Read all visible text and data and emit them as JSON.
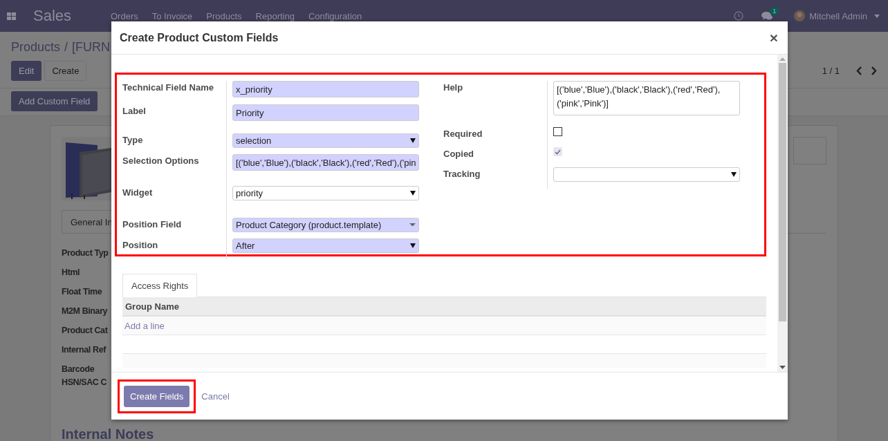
{
  "navbar": {
    "app_name": "Sales",
    "menu": [
      "Orders",
      "To Invoice",
      "Products",
      "Reporting",
      "Configuration"
    ],
    "message_count": "1",
    "user": "Mitchell Admin"
  },
  "control_panel": {
    "breadcrumb": [
      "Products",
      "[FURN"
    ],
    "separator": "/",
    "buttons": [
      "Edit",
      "Create"
    ],
    "custom_field_button": "Add Custom Field",
    "pager": "1 / 1"
  },
  "form": {
    "tab": "General In",
    "labels": [
      "Product Typ",
      "Html",
      "Float Time",
      "M2M Binary",
      "Product Cat",
      "Internal Ref",
      "Barcode",
      "HSN/SAC C"
    ],
    "section_title": "Internal Notes"
  },
  "dialog": {
    "title": "Create Product Custom Fields",
    "close": "×",
    "left_fields": [
      {
        "label": "Technical Field Name",
        "kind": "text",
        "value": "x_priority",
        "required": true
      },
      {
        "label": "Label",
        "kind": "text",
        "value": "Priority",
        "required": true
      },
      {
        "label": "Type",
        "kind": "select",
        "value": "selection",
        "required": true
      },
      {
        "label": "Selection Options",
        "kind": "text",
        "value": "[('blue','Blue'),('black','Black'),('red','Red'),('pin",
        "required": true
      },
      {
        "label": "Widget",
        "kind": "select",
        "value": "priority",
        "required": false
      },
      {
        "label": "Position Field",
        "kind": "many2one",
        "value": "Product Category (product.template)",
        "required": true
      },
      {
        "label": "Position",
        "kind": "select",
        "value": "After",
        "required": true
      }
    ],
    "right_fields": [
      {
        "label": "Help",
        "kind": "textarea",
        "value": "[('blue','Blue'),('black','Black'),('red','Red'),('pink','Pink')]",
        "required": false
      },
      {
        "label": "Required",
        "kind": "checkbox",
        "checked": false,
        "disabled": false
      },
      {
        "label": "Copied",
        "kind": "checkbox",
        "checked": true,
        "disabled": true
      },
      {
        "label": "Tracking",
        "kind": "select",
        "required": false
      }
    ],
    "tabs": [
      {
        "label": "Access Rights",
        "selected": true
      }
    ],
    "table": {
      "columns": [
        "Group Name"
      ],
      "add_line": "Add a line"
    },
    "buttons": [
      {
        "label": "Create Fields",
        "kind": "primary"
      },
      {
        "label": "Cancel",
        "kind": "link"
      }
    ]
  }
}
